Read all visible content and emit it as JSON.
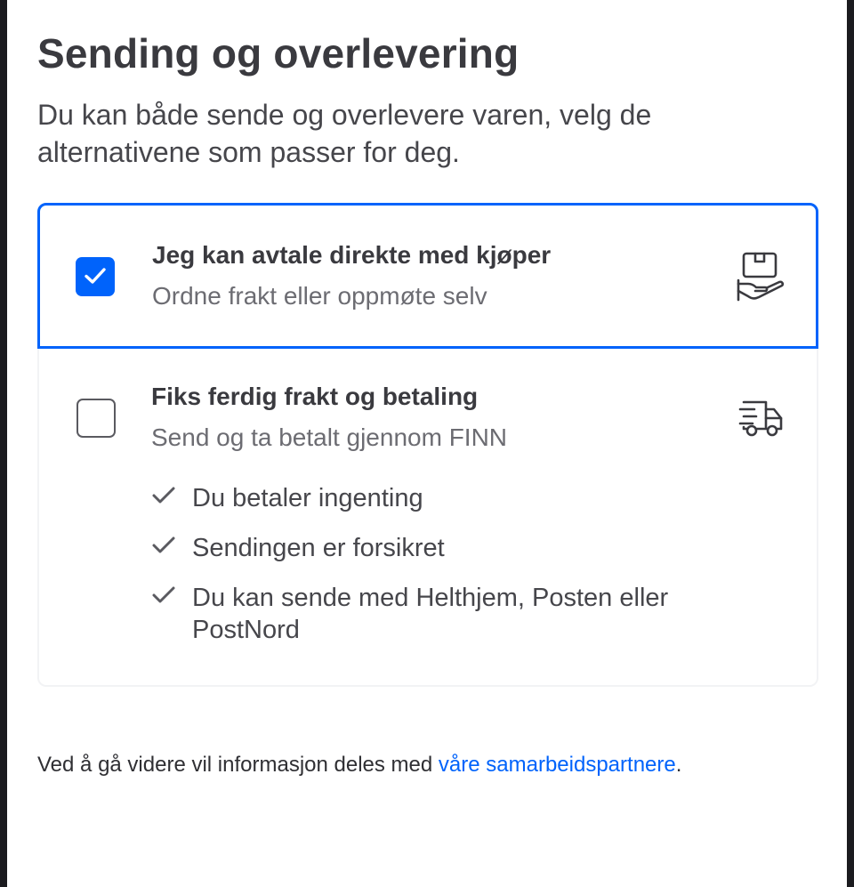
{
  "header": {
    "title": "Sending og overlevering",
    "intro": "Du kan både sende og overlevere varen, velg de alternativene som passer for deg."
  },
  "options": [
    {
      "title": "Jeg kan avtale direkte med kjøper",
      "subtitle": "Ordne frakt eller oppmøte selv",
      "checked": true,
      "icon": "hand-package-icon"
    },
    {
      "title": "Fiks ferdig frakt og betaling",
      "subtitle": "Send og ta betalt gjennom FINN",
      "checked": false,
      "icon": "delivery-truck-icon",
      "benefits": [
        "Du betaler ingenting",
        "Sendingen er forsikret",
        "Du kan sende med Helthjem, Posten eller PostNord"
      ]
    }
  ],
  "footer": {
    "text": "Ved å gå videre vil informasjon deles med ",
    "link": "våre samarbeidspartnere",
    "suffix": "."
  },
  "colors": {
    "accent": "#0063fb",
    "text": "#3a3a3f",
    "muted": "#6c6c72"
  }
}
